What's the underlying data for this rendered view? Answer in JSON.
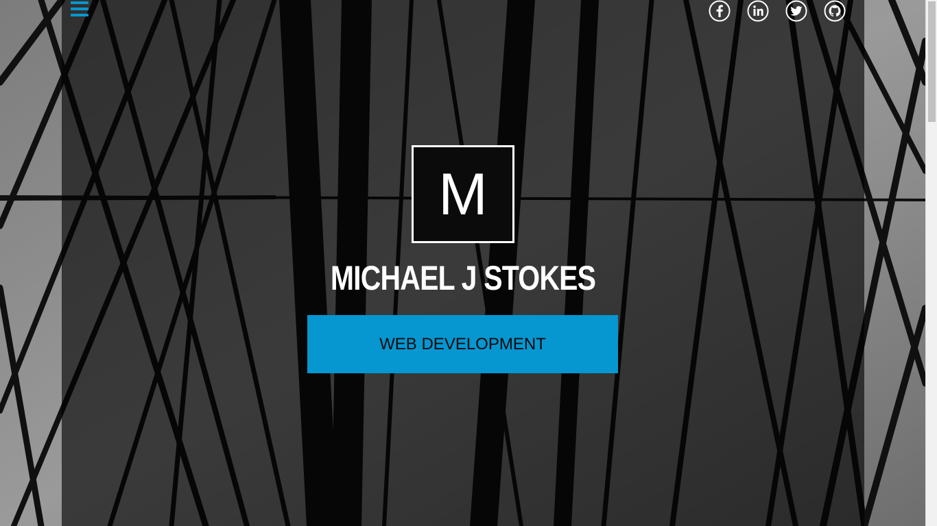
{
  "colors": {
    "accent": "#0696d0",
    "panel": "#0b0b0b",
    "text": "#ffffff"
  },
  "nav": {
    "menu_icon": "hamburger-menu-icon"
  },
  "social": {
    "items": [
      {
        "name": "facebook",
        "icon": "facebook-icon"
      },
      {
        "name": "linkedin",
        "icon": "linkedin-icon"
      },
      {
        "name": "twitter",
        "icon": "twitter-icon"
      },
      {
        "name": "github",
        "icon": "github-icon"
      }
    ]
  },
  "hero": {
    "logo_letter": "M",
    "name": "MICHAEL J STOKES",
    "cta_label": "WEB DEVELOPMENT"
  }
}
